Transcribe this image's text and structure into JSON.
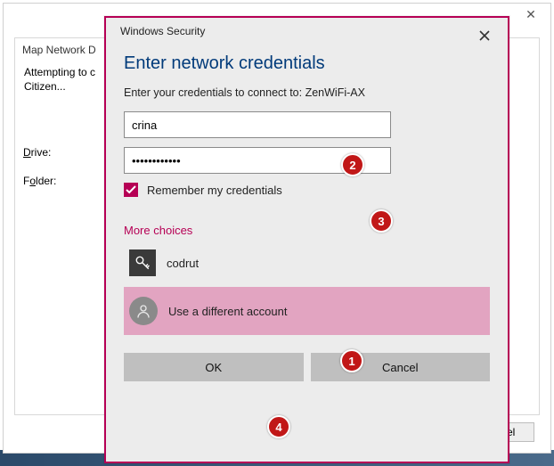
{
  "background_window": {
    "title": "Map Network D",
    "status_line1": "Attempting to c",
    "status_line2": "Citizen...",
    "label_drive": "Drive:",
    "label_folder": "Folder:",
    "cancel_partial": "ancel"
  },
  "dialog": {
    "title_small": "Windows Security",
    "heading": "Enter network credentials",
    "subtext": "Enter your credentials to connect to: ZenWiFi-AX",
    "username_value": "crina",
    "password_masked": "••••••••••••",
    "remember_label": "Remember my credentials",
    "more_choices": "More choices",
    "saved_account": "codrut",
    "different_account": "Use a different account",
    "ok": "OK",
    "cancel": "Cancel"
  },
  "annotations": {
    "a1": "1",
    "a2": "2",
    "a3": "3",
    "a4": "4"
  }
}
